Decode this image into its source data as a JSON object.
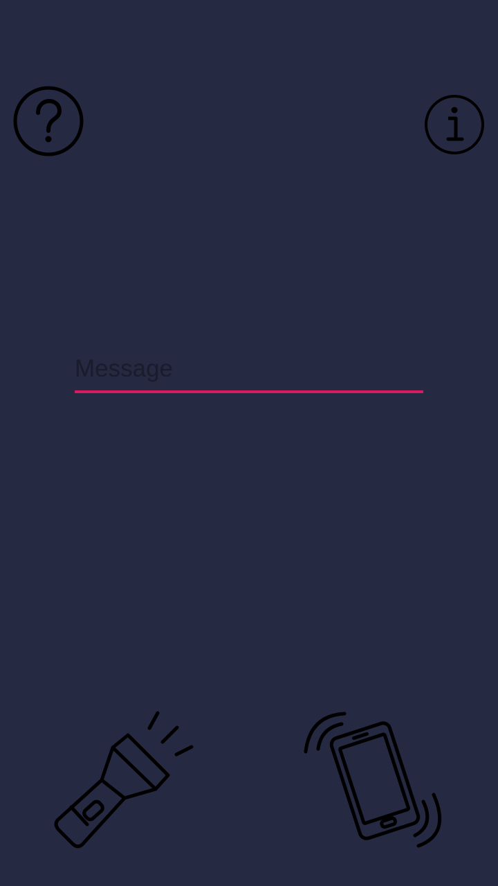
{
  "theme": {
    "background": "#262942",
    "accent": "#d81b60",
    "icon_color": "#000000"
  },
  "help": {
    "icon": "question-circle-icon"
  },
  "info": {
    "icon": "info-circle-icon"
  },
  "message": {
    "placeholder": "Message",
    "value": ""
  },
  "actions": {
    "flashlight": {
      "icon": "flashlight-icon"
    },
    "vibrate": {
      "icon": "vibrating-phone-icon"
    }
  }
}
